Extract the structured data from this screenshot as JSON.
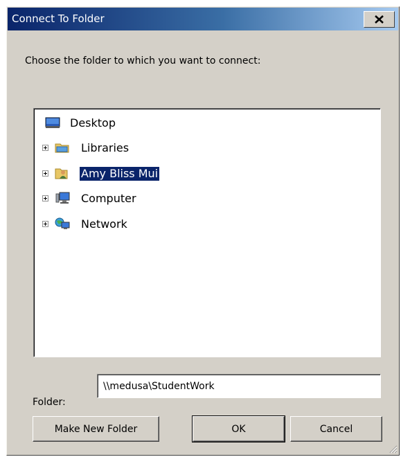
{
  "window": {
    "title": "Connect To Folder"
  },
  "instruction": "Choose the folder to which you want to connect:",
  "tree": {
    "items": [
      {
        "label": "Desktop",
        "icon": "desktop-icon",
        "expandable": false,
        "selected": false
      },
      {
        "label": "Libraries",
        "icon": "libraries-icon",
        "expandable": true,
        "selected": false
      },
      {
        "label": "Amy Bliss Mui",
        "icon": "user-folder-icon",
        "expandable": true,
        "selected": true
      },
      {
        "label": "Computer",
        "icon": "computer-icon",
        "expandable": true,
        "selected": false
      },
      {
        "label": "Network",
        "icon": "network-icon",
        "expandable": true,
        "selected": false
      }
    ]
  },
  "folder": {
    "label": "Folder:",
    "value": "\\\\medusa\\StudentWork"
  },
  "buttons": {
    "make_new_folder": "Make New Folder",
    "ok": "OK",
    "cancel": "Cancel"
  },
  "colors": {
    "selection": "#0a246a",
    "title_start": "#0a246a",
    "title_end": "#a6caf0",
    "face": "#d4d0c8"
  }
}
